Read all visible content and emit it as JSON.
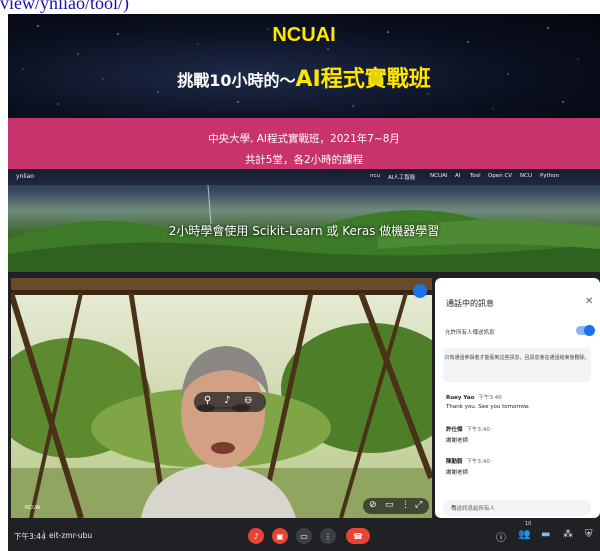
{
  "url_fragment": "view/ynliao/tool/)",
  "banner": {
    "brand": "NCUAI",
    "tagline_prefix": "挑戰10小時的～",
    "tagline_highlight": "AI程式實戰班"
  },
  "info": {
    "line1": "中央大學, AI程式實戰班，2021年7~8月",
    "line2": "共計5堂，各2小時的課程"
  },
  "site": {
    "logo": "ynliao",
    "nav": [
      "ncu",
      "AI人工智能",
      "NCUAI",
      "AI",
      "Tool",
      "Open CV",
      "NCU",
      "Python"
    ],
    "headline": "2小時學會使用 Scikit-Learn 或 Keras 做機器學習"
  },
  "chat": {
    "title": "通話中的訊息",
    "toggle_label": "允許所有人傳送訊息",
    "toggle_on": true,
    "notice": "只有通話參與者才能看到這些訊息，且訊息會在通話結束後刪除。",
    "messages": [
      {
        "sender": "Ruey Yao",
        "time": "下午3:40",
        "text": "Thank you. See you tomorrow."
      },
      {
        "sender": "許仕傑",
        "time": "下午3:40",
        "text": "謝謝老師"
      },
      {
        "sender": "陳勤毅",
        "time": "下午3:40",
        "text": "謝謝老師"
      }
    ],
    "input_placeholder": "傳送訊息給所有人"
  },
  "toolbar": {
    "time": "下午3:44",
    "meeting_code": "eit-zmr-ubu",
    "participants_badge": "10"
  },
  "colors": {
    "accent_yellow": "#ffe600",
    "pink_strip": "#c8336c",
    "meet_bg": "#202124",
    "hangup_red": "#ea4335",
    "mic_red": "#ea4335",
    "chat_blue": "#8ab4f8"
  },
  "icons": {
    "close": "close-icon",
    "send": "send-icon",
    "mic": "mic-off-icon",
    "camera": "camera-off-icon",
    "present": "present-icon",
    "more": "more-options-icon",
    "hangup": "hangup-icon",
    "info": "info-icon",
    "people": "people-icon",
    "chat": "chat-icon",
    "activities": "activities-icon",
    "host": "host-controls-icon"
  }
}
